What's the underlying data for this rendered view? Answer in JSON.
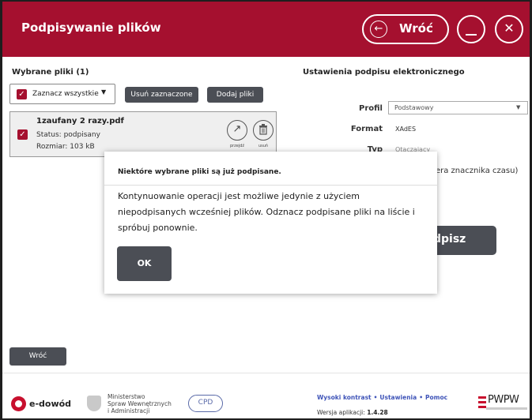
{
  "header": {
    "title": "Podpisywanie plików",
    "back_label": "Wróć",
    "back_arrow": "←",
    "close_glyph": "✕"
  },
  "left": {
    "section_title": "Wybrane pliki (1)",
    "select_all": {
      "label": "Zaznacz wszystkie",
      "checked": true
    },
    "remove_selected_label": "Usuń zaznaczone",
    "add_files_label": "Dodaj pliki",
    "file": {
      "name": "1zaufany 2 razy.pdf",
      "status": "Status: podpisany",
      "size": "Rozmiar: 103 kB",
      "open_label": "przejdź",
      "delete_label": "usuń"
    }
  },
  "right": {
    "section_title": "Ustawienia podpisu elektronicznego",
    "profil_label": "Profil",
    "profil_value": "Podstawowy",
    "format_label": "Format",
    "format_value": "XAdES",
    "type_label": "Typ",
    "type_value": "Otaczający",
    "timestamp_fragment": "wiera znacznika czasu)",
    "sign_fragment": "dpisz"
  },
  "modal": {
    "title": "Niektóre wybrane pliki są już podpisane.",
    "body": "Kontynuowanie operacji jest możliwe jedynie z użyciem niepodpisanych wcześniej plików. Odznacz podpisane pliki na liście i spróbuj ponownie.",
    "ok_label": "OK"
  },
  "bottom_back_label": "Wróć",
  "footer": {
    "edowod": "e-dowód",
    "ministry_line1": "Ministerstwo",
    "ministry_line2": "Spraw Wewnętrznych",
    "ministry_line3": "i Administracji",
    "cpd": "CPD",
    "link_high_contrast": "Wysoki kontrast",
    "link_settings": "Ustawienia",
    "link_help": "Pomoc",
    "version_label": "Wersja aplikacji:",
    "version_value": "1.4.28",
    "pwpw": "PWPW"
  },
  "colors": {
    "brand": "#a5102f",
    "button_dark": "#4b4e55",
    "link": "#3f54b8"
  },
  "icons": {
    "open": "arrow-up-right-icon",
    "delete": "trash-icon",
    "back": "arrow-left-icon",
    "minimize": "minimize-icon",
    "close": "close-icon"
  }
}
